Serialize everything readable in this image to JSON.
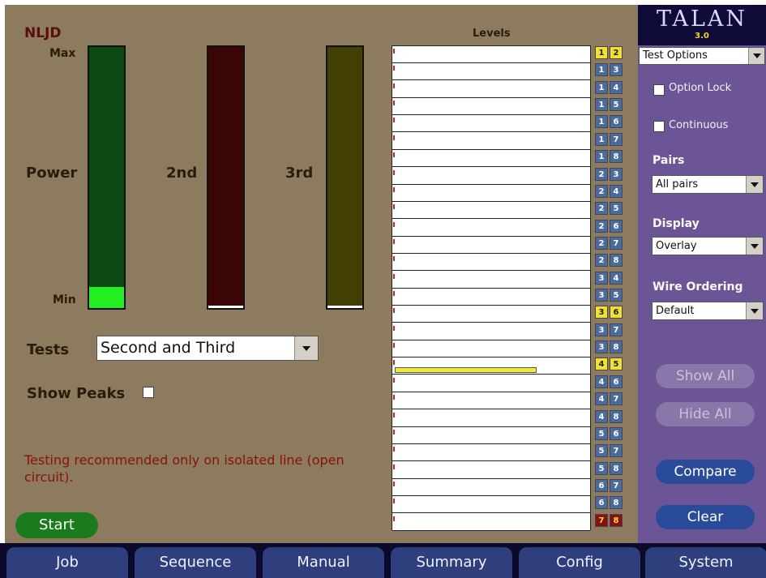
{
  "nljd": {
    "title": "NLJD",
    "max_label": "Max",
    "min_label": "Min",
    "meters": [
      {
        "label": "Power",
        "level": 0.08,
        "bg": "#0b4a12",
        "fill": "#22ee22"
      },
      {
        "label": "2nd",
        "level": 0.0,
        "bg": "#3d0606",
        "fill": "#ffffff"
      },
      {
        "label": "3rd",
        "level": 0.0,
        "bg": "#434004",
        "fill": "#ffffff"
      }
    ]
  },
  "tests": {
    "label": "Tests",
    "value": "Second and Third"
  },
  "show_peaks": {
    "label": "Show Peaks",
    "checked": false
  },
  "warning": "Testing recommended only on isolated line (open circuit).",
  "start_label": "Start",
  "levels": {
    "title": "Levels",
    "rows": [
      {
        "a": "1",
        "b": "2",
        "style": "yellow",
        "level": 0
      },
      {
        "a": "1",
        "b": "3",
        "style": "blue",
        "level": 0
      },
      {
        "a": "1",
        "b": "4",
        "style": "blue",
        "level": 0
      },
      {
        "a": "1",
        "b": "5",
        "style": "blue",
        "level": 0
      },
      {
        "a": "1",
        "b": "6",
        "style": "blue",
        "level": 0
      },
      {
        "a": "1",
        "b": "7",
        "style": "blue",
        "level": 0
      },
      {
        "a": "1",
        "b": "8",
        "style": "blue",
        "level": 0
      },
      {
        "a": "2",
        "b": "3",
        "style": "blue",
        "level": 0
      },
      {
        "a": "2",
        "b": "4",
        "style": "blue",
        "level": 0
      },
      {
        "a": "2",
        "b": "5",
        "style": "blue",
        "level": 0
      },
      {
        "a": "2",
        "b": "6",
        "style": "blue",
        "level": 0
      },
      {
        "a": "2",
        "b": "7",
        "style": "blue",
        "level": 0
      },
      {
        "a": "2",
        "b": "8",
        "style": "blue",
        "level": 0
      },
      {
        "a": "3",
        "b": "4",
        "style": "blue",
        "level": 0
      },
      {
        "a": "3",
        "b": "5",
        "style": "blue",
        "level": 0
      },
      {
        "a": "3",
        "b": "6",
        "style": "yellow",
        "level": 0
      },
      {
        "a": "3",
        "b": "7",
        "style": "blue",
        "level": 0
      },
      {
        "a": "3",
        "b": "8",
        "style": "blue",
        "level": 0
      },
      {
        "a": "4",
        "b": "5",
        "style": "yellow",
        "level": 0.73
      },
      {
        "a": "4",
        "b": "6",
        "style": "blue",
        "level": 0
      },
      {
        "a": "4",
        "b": "7",
        "style": "blue",
        "level": 0
      },
      {
        "a": "4",
        "b": "8",
        "style": "blue",
        "level": 0
      },
      {
        "a": "5",
        "b": "6",
        "style": "blue",
        "level": 0
      },
      {
        "a": "5",
        "b": "7",
        "style": "blue",
        "level": 0
      },
      {
        "a": "5",
        "b": "8",
        "style": "blue",
        "level": 0
      },
      {
        "a": "6",
        "b": "7",
        "style": "blue",
        "level": 0
      },
      {
        "a": "6",
        "b": "8",
        "style": "blue",
        "level": 0
      },
      {
        "a": "7",
        "b": "8",
        "style": "red",
        "level": 0
      }
    ]
  },
  "sidebar": {
    "logo": "TALAN",
    "version": "3.0",
    "mode_select": "Test Options",
    "option_lock": {
      "label": "Option Lock",
      "checked": false
    },
    "continuous": {
      "label": "Continuous",
      "checked": false
    },
    "pairs": {
      "label": "Pairs",
      "value": "All pairs"
    },
    "display": {
      "label": "Display",
      "value": "Overlay"
    },
    "wire_ordering": {
      "label": "Wire Ordering",
      "value": "Default"
    },
    "show_all": "Show All",
    "hide_all": "Hide All",
    "compare": "Compare",
    "clear": "Clear"
  },
  "nav": [
    "Job",
    "Sequence",
    "Manual",
    "Summary",
    "Config",
    "System"
  ],
  "colors": {
    "panel_bg": "#8d7b60",
    "sidebar_bg": "#6b5596",
    "title_red": "#5c0c0c",
    "warning_text": "#8a1010",
    "pair_blue": "#4a6c9c",
    "pair_yellow": "#f0e030",
    "pair_red": "#8a1010"
  }
}
